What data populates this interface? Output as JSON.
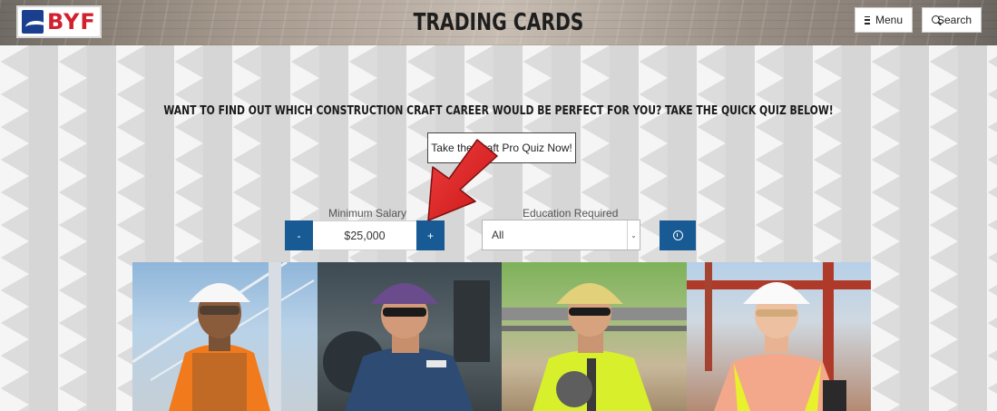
{
  "header": {
    "logo_text": "BYF",
    "title": "TRADING CARDS",
    "menu_label": "Menu",
    "search_label": "Search"
  },
  "quiz": {
    "heading": "WANT TO FIND OUT WHICH CONSTRUCTION CRAFT CAREER WOULD BE PERFECT FOR YOU? TAKE THE QUICK QUIZ BELOW!",
    "button_label": "Take the Craft Pro Quiz Now!"
  },
  "filters": {
    "salary_label": "Minimum Salary",
    "minus_label": "-",
    "plus_label": "+",
    "salary_value": "$25,000",
    "education_label": "Education Required",
    "education_value": "All"
  },
  "cards": [
    {
      "name": "card-worker-1"
    },
    {
      "name": "card-worker-2"
    },
    {
      "name": "card-worker-3"
    },
    {
      "name": "card-worker-4"
    }
  ],
  "colors": {
    "accent_blue": "#185a93",
    "brand_red": "#d2202f",
    "brand_navy": "#1a3f8f",
    "annotation_red": "#e31b1b"
  },
  "icons": {
    "menu": "hamburger-icon",
    "search": "search-icon",
    "info": "info-icon",
    "dropdown": "chevron-down-icon"
  }
}
